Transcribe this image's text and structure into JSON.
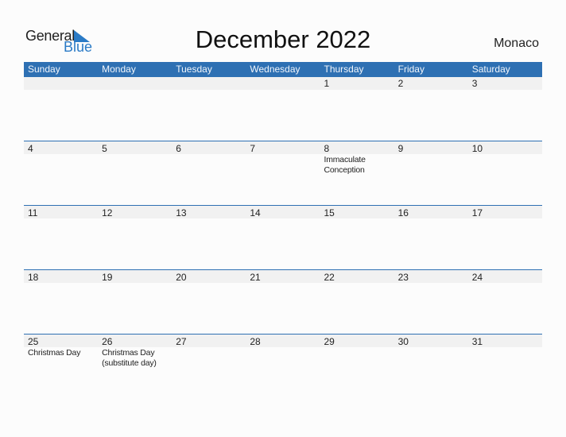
{
  "logo": {
    "word1": "General",
    "word2": "Blue",
    "icon": "flag-triangle-icon",
    "brand_color": "#2b7bc6"
  },
  "title": "December 2022",
  "country": "Monaco",
  "colors": {
    "header_bg": "#2e70b3",
    "header_text": "#f2f6fb",
    "band_bg": "#f1f1f1",
    "page_bg": "#fcfcfc"
  },
  "weekdays": [
    "Sunday",
    "Monday",
    "Tuesday",
    "Wednesday",
    "Thursday",
    "Friday",
    "Saturday"
  ],
  "weeks": [
    [
      {
        "day": "",
        "holiday": ""
      },
      {
        "day": "",
        "holiday": ""
      },
      {
        "day": "",
        "holiday": ""
      },
      {
        "day": "",
        "holiday": ""
      },
      {
        "day": "1",
        "holiday": ""
      },
      {
        "day": "2",
        "holiday": ""
      },
      {
        "day": "3",
        "holiday": ""
      }
    ],
    [
      {
        "day": "4",
        "holiday": ""
      },
      {
        "day": "5",
        "holiday": ""
      },
      {
        "day": "6",
        "holiday": ""
      },
      {
        "day": "7",
        "holiday": ""
      },
      {
        "day": "8",
        "holiday": "Immaculate Conception"
      },
      {
        "day": "9",
        "holiday": ""
      },
      {
        "day": "10",
        "holiday": ""
      }
    ],
    [
      {
        "day": "11",
        "holiday": ""
      },
      {
        "day": "12",
        "holiday": ""
      },
      {
        "day": "13",
        "holiday": ""
      },
      {
        "day": "14",
        "holiday": ""
      },
      {
        "day": "15",
        "holiday": ""
      },
      {
        "day": "16",
        "holiday": ""
      },
      {
        "day": "17",
        "holiday": ""
      }
    ],
    [
      {
        "day": "18",
        "holiday": ""
      },
      {
        "day": "19",
        "holiday": ""
      },
      {
        "day": "20",
        "holiday": ""
      },
      {
        "day": "21",
        "holiday": ""
      },
      {
        "day": "22",
        "holiday": ""
      },
      {
        "day": "23",
        "holiday": ""
      },
      {
        "day": "24",
        "holiday": ""
      }
    ],
    [
      {
        "day": "25",
        "holiday": "Christmas Day"
      },
      {
        "day": "26",
        "holiday": "Christmas Day (substitute day)"
      },
      {
        "day": "27",
        "holiday": ""
      },
      {
        "day": "28",
        "holiday": ""
      },
      {
        "day": "29",
        "holiday": ""
      },
      {
        "day": "30",
        "holiday": ""
      },
      {
        "day": "31",
        "holiday": ""
      }
    ]
  ]
}
